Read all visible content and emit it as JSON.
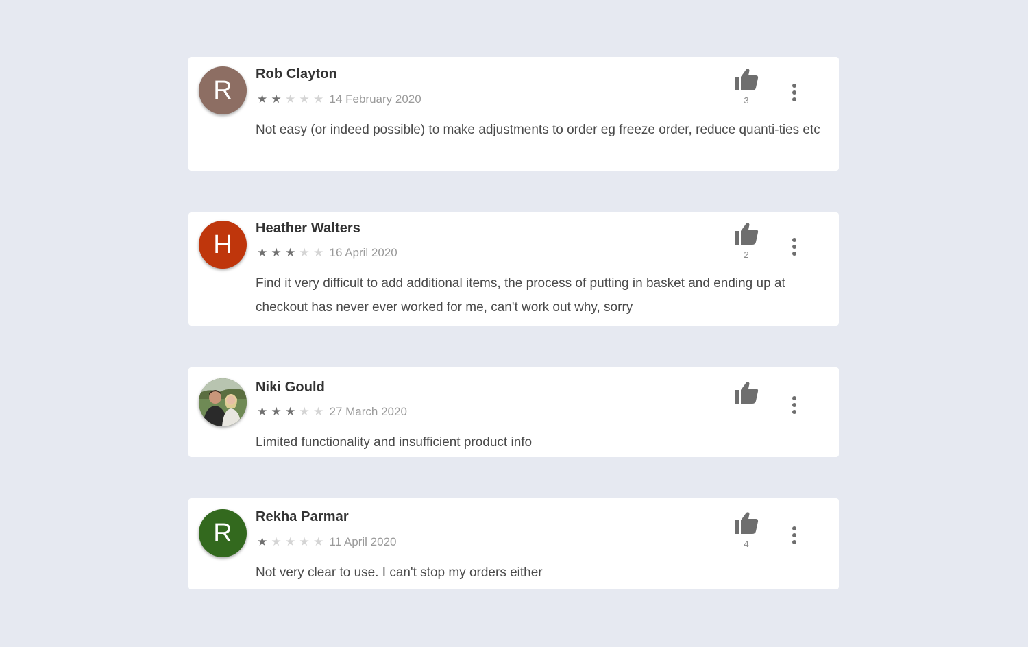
{
  "reviews": [
    {
      "name": "Rob Clayton",
      "avatar_letter": "R",
      "avatar_color": "#8d6e63",
      "avatar_type": "letter",
      "rating": 2,
      "date": "14 February 2020",
      "text": "Not easy (or indeed possible) to make adjustments to order eg freeze order, reduce quanti-ties etc",
      "likes": "3"
    },
    {
      "name": "Heather Walters",
      "avatar_letter": "H",
      "avatar_color": "#bf360c",
      "avatar_type": "letter",
      "rating": 3,
      "date": "16 April 2020",
      "text": "Find it very difficult to add additional items, the process of putting in basket and ending up at checkout has never ever worked for me, can't work out why, sorry",
      "likes": "2"
    },
    {
      "name": "Niki Gould",
      "avatar_letter": "",
      "avatar_color": "#6d7a5a",
      "avatar_type": "photo",
      "rating": 3,
      "date": "27 March 2020",
      "text": "Limited functionality and insufficient product info",
      "likes": ""
    },
    {
      "name": "Rekha Parmar",
      "avatar_letter": "R",
      "avatar_color": "#33691e",
      "avatar_type": "letter",
      "rating": 1,
      "date": "11 April 2020",
      "text": "Not very clear to use. I can't stop my orders either",
      "likes": "4"
    }
  ],
  "max_rating": 5,
  "icons": {
    "like": "thumbs-up-icon",
    "more": "more-vertical-icon",
    "star": "star-icon"
  },
  "colors": {
    "background": "#e6e9f1",
    "card": "#ffffff",
    "star_on": "#707070",
    "star_off": "#d4d4d4"
  }
}
